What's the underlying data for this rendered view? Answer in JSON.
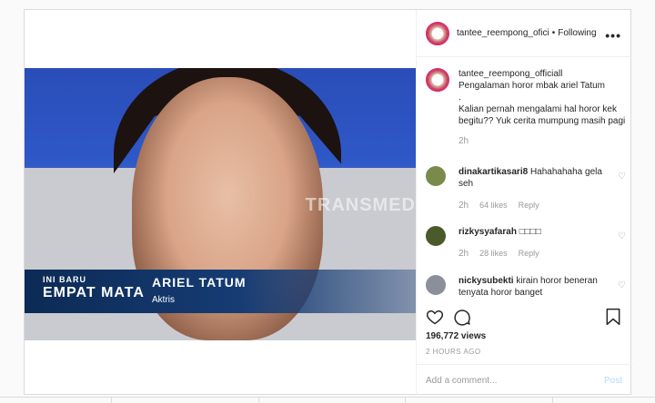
{
  "header": {
    "username": "tantee_reempong_ofici",
    "separator": "•",
    "follow_status": "Following",
    "more_icon": "more-horizontal-icon",
    "more_glyph": "•••"
  },
  "media": {
    "watermark": "TRANSMED",
    "show_top": "INI BARU",
    "show_bottom": "EMPAT MATA",
    "guest_name": "ARIEL TATUM",
    "guest_role": "Aktris"
  },
  "caption": {
    "username": "tantee_reempong_officiall",
    "line1": "Pengalaman horor mbak ariel Tatum",
    "line2": ".",
    "line3": "Kalian pernah mengalami hal horor kek begitu?? Yuk cerita mumpung masih pagi",
    "time": "2h"
  },
  "comments": [
    {
      "username": "dinakartikasari8",
      "text": "Hahahahaha gela seh",
      "time": "2h",
      "likes": "64 likes",
      "reply": "Reply",
      "avatar_color": "#7a8a4a"
    },
    {
      "username": "rizkysyafarah",
      "text": "□□□□",
      "time": "2h",
      "likes": "28 likes",
      "reply": "Reply",
      "avatar_color": "#4a5a2a"
    },
    {
      "username": "nickysubekti",
      "text": "kirain horor beneran tenyata horor banget",
      "avatar_color": "#8a8f9a"
    }
  ],
  "actions": {
    "like_icon": "heart-icon",
    "comment_icon": "comment-icon",
    "save_icon": "bookmark-icon"
  },
  "views": "196,772 views",
  "posted_ago": "2 HOURS AGO",
  "add_comment": {
    "placeholder": "Add a comment...",
    "post_label": "Post"
  },
  "colors": {
    "follow_link": "#262626",
    "post_disabled": "#b3dbff",
    "story_ring": "#d62976"
  }
}
